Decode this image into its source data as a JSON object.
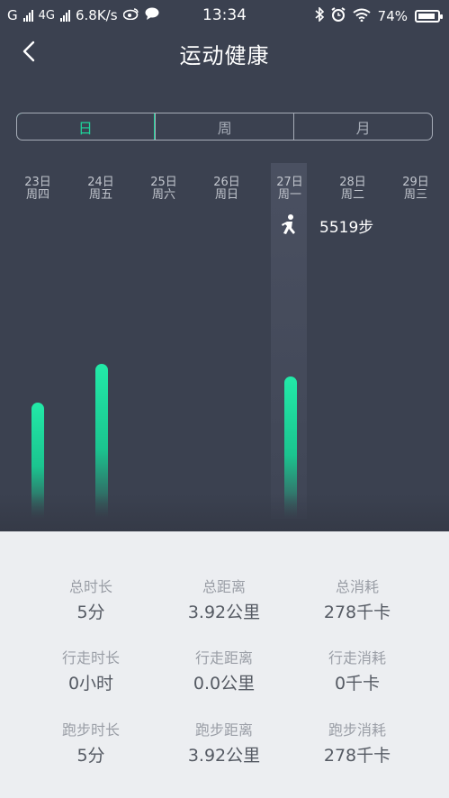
{
  "status_bar": {
    "carrier1": "G",
    "carrier2": "4G",
    "speed": "6.8K/s",
    "time": "13:34",
    "battery": "74%"
  },
  "header": {
    "title": "运动健康"
  },
  "tabs": [
    {
      "label": "日",
      "active": true
    },
    {
      "label": "周",
      "active": false
    },
    {
      "label": "月",
      "active": false
    }
  ],
  "days": [
    {
      "date": "23日",
      "weekday": "周四"
    },
    {
      "date": "24日",
      "weekday": "周五"
    },
    {
      "date": "25日",
      "weekday": "周六"
    },
    {
      "date": "26日",
      "weekday": "周日"
    },
    {
      "date": "27日",
      "weekday": "周一"
    },
    {
      "date": "28日",
      "weekday": "周二"
    },
    {
      "date": "29日",
      "weekday": "周三"
    }
  ],
  "selected": {
    "steps_label": "5519步"
  },
  "chart_data": {
    "type": "bar",
    "categories": [
      "23日",
      "24日",
      "25日",
      "26日",
      "27日",
      "28日",
      "29日"
    ],
    "values": [
      4500,
      6000,
      0,
      0,
      5519,
      0,
      0
    ],
    "selected_index": 4,
    "accent_color": "#1ed59b"
  },
  "stats": [
    {
      "label": "总时长",
      "value": "5分"
    },
    {
      "label": "总距离",
      "value": "3.92公里"
    },
    {
      "label": "总消耗",
      "value": "278千卡"
    },
    {
      "label": "行走时长",
      "value": "0小时"
    },
    {
      "label": "行走距离",
      "value": "0.0公里"
    },
    {
      "label": "行走消耗",
      "value": "0千卡"
    },
    {
      "label": "跑步时长",
      "value": "5分"
    },
    {
      "label": "跑步距离",
      "value": "3.92公里"
    },
    {
      "label": "跑步消耗",
      "value": "278千卡"
    }
  ]
}
